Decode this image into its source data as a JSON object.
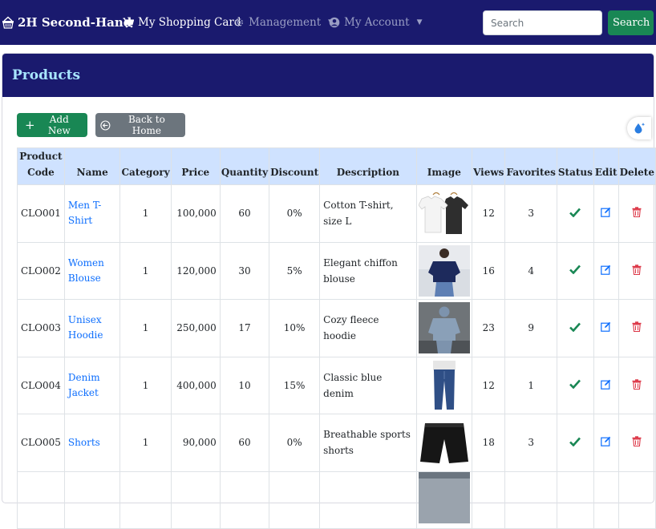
{
  "navbar": {
    "brand": "2H Second-Hand",
    "items": [
      {
        "label": "My Shopping Card"
      },
      {
        "label": "Management"
      },
      {
        "label": "My Account"
      }
    ],
    "search_placeholder": "Search",
    "search_button": "Search"
  },
  "page": {
    "title": "Products",
    "add_new": "Add New",
    "back_home": "Back to Home"
  },
  "table": {
    "headers": [
      "Product Code",
      "Name",
      "Category",
      "Price",
      "Quantity",
      "Discount",
      "Description",
      "Image",
      "Views",
      "Favorites",
      "Status",
      "Edit",
      "Delete"
    ],
    "rows": [
      {
        "code": "CLO001",
        "name": "Men T-Shirt",
        "category": "1",
        "price": "100,000",
        "quantity": "60",
        "discount": "0%",
        "description": "Cotton T-shirt, size L",
        "image": "t-shirts",
        "views": "12",
        "favorites": "3"
      },
      {
        "code": "CLO002",
        "name": "Women Blouse",
        "category": "1",
        "price": "120,000",
        "quantity": "30",
        "discount": "5%",
        "description": "Elegant chiffon blouse",
        "image": "blouse",
        "views": "16",
        "favorites": "4"
      },
      {
        "code": "CLO003",
        "name": "Unisex Hoodie",
        "category": "1",
        "price": "250,000",
        "quantity": "17",
        "discount": "10%",
        "description": "Cozy fleece hoodie",
        "image": "hoodie",
        "views": "23",
        "favorites": "9"
      },
      {
        "code": "CLO004",
        "name": "Denim Jacket",
        "category": "1",
        "price": "400,000",
        "quantity": "10",
        "discount": "15%",
        "description": "Classic blue denim",
        "image": "jeans",
        "views": "12",
        "favorites": "1"
      },
      {
        "code": "CLO005",
        "name": "Shorts",
        "category": "1",
        "price": "90,000",
        "quantity": "60",
        "discount": "0%",
        "description": "Breathable sports shorts",
        "image": "shorts",
        "views": "18",
        "favorites": "3"
      }
    ]
  },
  "icons": {
    "brand": "basket-icon",
    "cart": "cart-icon",
    "management": "gear-icon",
    "account": "user-circle-icon",
    "status": "check-icon",
    "edit": "edit-icon",
    "delete": "trash-icon"
  },
  "colors": {
    "navbar": "#1a1a6e",
    "title": "#a8e6ff",
    "success": "#198754",
    "secondary": "#6c757d",
    "link": "#0d6efd",
    "danger": "#dc3545",
    "table_header": "#cfe2ff"
  }
}
